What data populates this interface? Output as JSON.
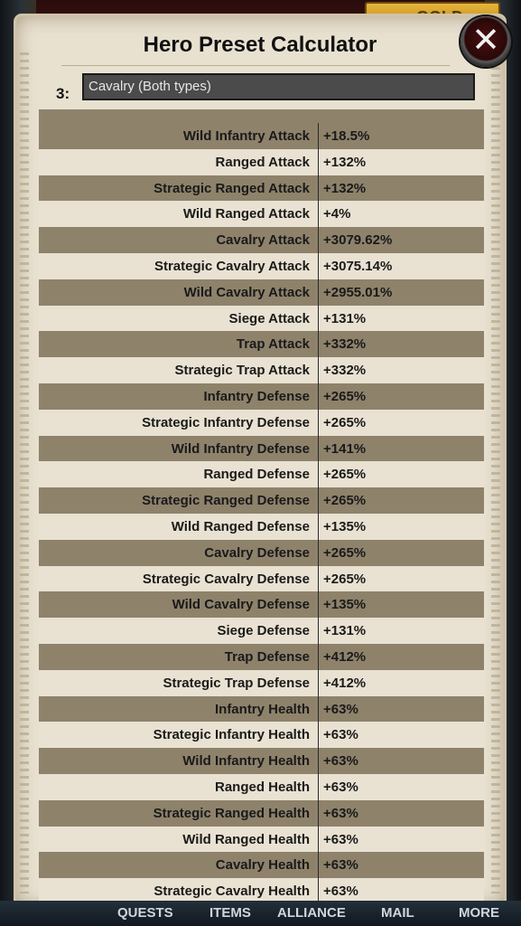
{
  "header": {
    "gold_label": "GOLD"
  },
  "panel": {
    "title": "Hero Preset Calculator",
    "index_label": "3:",
    "dropdown_value": "Cavalry (Both types)",
    "close_label": "✕"
  },
  "rows": [
    {
      "label": "Wild Infantry Attack",
      "value": "+18.5%"
    },
    {
      "label": "Ranged Attack",
      "value": "+132%"
    },
    {
      "label": "Strategic Ranged Attack",
      "value": "+132%"
    },
    {
      "label": "Wild Ranged Attack",
      "value": "+4%"
    },
    {
      "label": "Cavalry Attack",
      "value": "+3079.62%"
    },
    {
      "label": "Strategic Cavalry Attack",
      "value": "+3075.14%"
    },
    {
      "label": "Wild Cavalry Attack",
      "value": "+2955.01%"
    },
    {
      "label": "Siege Attack",
      "value": "+131%"
    },
    {
      "label": "Trap Attack",
      "value": "+332%"
    },
    {
      "label": "Strategic Trap Attack",
      "value": "+332%"
    },
    {
      "label": "Infantry Defense",
      "value": "+265%"
    },
    {
      "label": "Strategic Infantry Defense",
      "value": "+265%"
    },
    {
      "label": "Wild Infantry Defense",
      "value": "+141%"
    },
    {
      "label": "Ranged Defense",
      "value": "+265%"
    },
    {
      "label": "Strategic Ranged Defense",
      "value": "+265%"
    },
    {
      "label": "Wild Ranged Defense",
      "value": "+135%"
    },
    {
      "label": "Cavalry Defense",
      "value": "+265%"
    },
    {
      "label": "Strategic Cavalry Defense",
      "value": "+265%"
    },
    {
      "label": "Wild Cavalry Defense",
      "value": "+135%"
    },
    {
      "label": "Siege Defense",
      "value": "+131%"
    },
    {
      "label": "Trap Defense",
      "value": "+412%"
    },
    {
      "label": "Strategic Trap Defense",
      "value": "+412%"
    },
    {
      "label": "Infantry Health",
      "value": "+63%"
    },
    {
      "label": "Strategic Infantry Health",
      "value": "+63%"
    },
    {
      "label": "Wild Infantry Health",
      "value": "+63%"
    },
    {
      "label": "Ranged Health",
      "value": "+63%"
    },
    {
      "label": "Strategic Ranged Health",
      "value": "+63%"
    },
    {
      "label": "Wild Ranged Health",
      "value": "+63%"
    },
    {
      "label": "Cavalry Health",
      "value": "+63%"
    },
    {
      "label": "Strategic Cavalry Health",
      "value": "+63%"
    }
  ],
  "bottom_nav": [
    "QUESTS",
    "ITEMS",
    "ALLIANCE",
    "MAIL",
    "MORE"
  ],
  "colors": {
    "row_dark": "#8e826b",
    "row_light": "#e9e2d2",
    "panel": "#e8e1d0"
  }
}
